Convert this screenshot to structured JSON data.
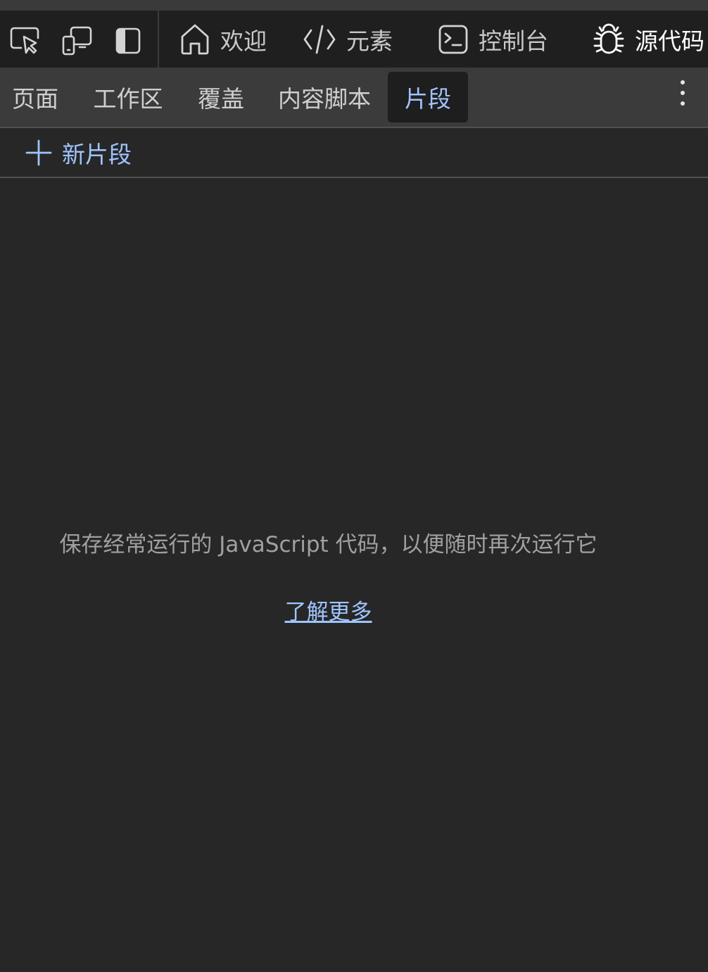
{
  "toolbar": {
    "tools": [
      {
        "icon": "inspect-icon"
      },
      {
        "icon": "device-emulation-icon"
      },
      {
        "icon": "dock-panel-icon"
      }
    ],
    "tabs": [
      {
        "label": "欢迎",
        "icon": "home-icon"
      },
      {
        "label": "元素",
        "icon": "code-brackets-icon"
      },
      {
        "label": "控制台",
        "icon": "console-icon"
      },
      {
        "label": "源代码",
        "icon": "bug-icon",
        "active": true
      }
    ]
  },
  "subtabs": [
    {
      "label": "页面"
    },
    {
      "label": "工作区"
    },
    {
      "label": "覆盖"
    },
    {
      "label": "内容脚本"
    },
    {
      "label": "片段",
      "active": true
    }
  ],
  "snippets": {
    "new_label": "新片段",
    "empty_message": "保存经常运行的 JavaScript 代码，以便随时再次运行它",
    "learn_more": "了解更多"
  },
  "colors": {
    "accent": "#0f6cbd",
    "link": "#9fc4ff",
    "background": "#272727"
  }
}
